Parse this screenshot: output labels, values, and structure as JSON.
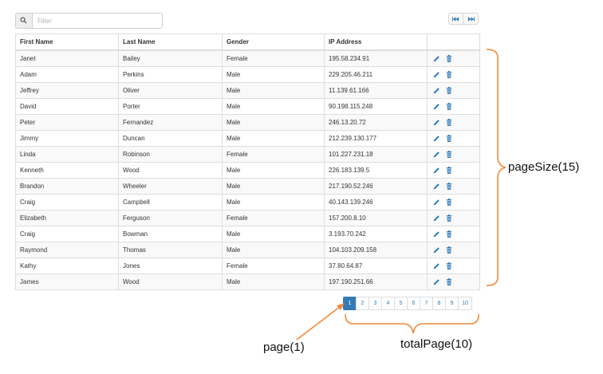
{
  "filter": {
    "placeholder": "Filter",
    "icon": "search-icon"
  },
  "nav_buttons": [
    {
      "icon": "fast-backward-icon"
    },
    {
      "icon": "fast-forward-icon"
    }
  ],
  "table": {
    "headers": [
      "First Name",
      "Last Name",
      "Gender",
      "IP Address",
      ""
    ],
    "rows": [
      [
        "Janet",
        "Bailey",
        "Female",
        "195.58.234.91"
      ],
      [
        "Adam",
        "Perkins",
        "Male",
        "229.205.46.211"
      ],
      [
        "Jeffrey",
        "Oliver",
        "Male",
        "11.139.61.166"
      ],
      [
        "David",
        "Porter",
        "Male",
        "90.198.115.248"
      ],
      [
        "Peter",
        "Fernandez",
        "Male",
        "246.13.20.72"
      ],
      [
        "Jimmy",
        "Duncan",
        "Male",
        "212.239.130.177"
      ],
      [
        "Linda",
        "Robinson",
        "Female",
        "101.227.231.18"
      ],
      [
        "Kenneth",
        "Wood",
        "Male",
        "226.183.139.5"
      ],
      [
        "Brandon",
        "Wheeler",
        "Male",
        "217.190.52.246"
      ],
      [
        "Craig",
        "Campbell",
        "Male",
        "40.143.139.246"
      ],
      [
        "Elizabeth",
        "Ferguson",
        "Female",
        "157.200.8.10"
      ],
      [
        "Craig",
        "Bowman",
        "Male",
        "3.193.70.242"
      ],
      [
        "Raymond",
        "Thomas",
        "Male",
        "104.103.209.158"
      ],
      [
        "Kathy",
        "Jones",
        "Female",
        "37.80.64.87"
      ],
      [
        "James",
        "Wood",
        "Male",
        "197.190.251.66"
      ]
    ],
    "row_actions": [
      "edit-pencil-icon",
      "trash-icon"
    ]
  },
  "pagination": {
    "pages": [
      "1",
      "2",
      "3",
      "4",
      "5",
      "6",
      "7",
      "8",
      "9",
      "10"
    ],
    "active": "1"
  },
  "annotations": {
    "page_size": "pageSize(15)",
    "page": "page(1)",
    "total_page": "totalPage(10)",
    "color": "#f08a3c"
  },
  "colors": {
    "accent": "#337ab7",
    "annotation": "#f08a3c"
  }
}
